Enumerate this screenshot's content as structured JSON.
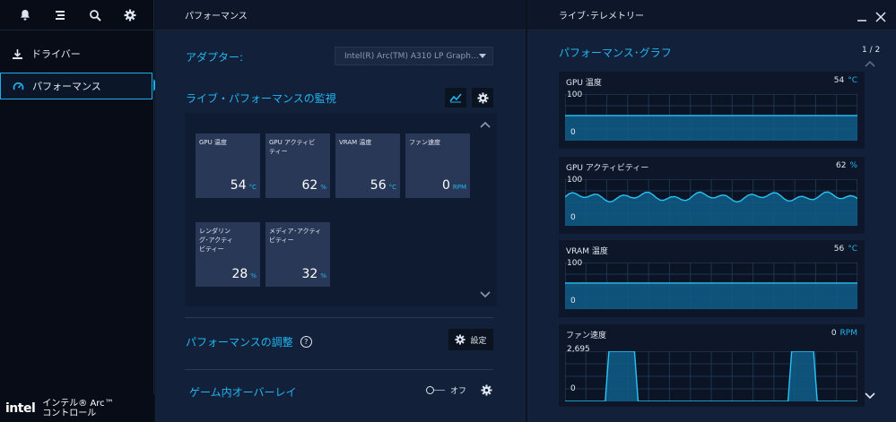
{
  "sidebar": {
    "top_icons": [
      "bell-icon",
      "menu-icon",
      "search-icon",
      "gear-icon"
    ],
    "items": [
      {
        "label": "ドライバー",
        "icon": "download-icon"
      },
      {
        "label": "パフォーマンス",
        "icon": "gauge-icon"
      }
    ],
    "brand": {
      "logo": "intel",
      "line1": "インテル® Arc™",
      "line2": "コントロール"
    }
  },
  "performance": {
    "header": "パフォーマンス",
    "adapter_label": "アダプター:",
    "adapter_value": "Intel(R) Arc(TM) A310 LP Graph…",
    "monitor_title": "ライブ・パフォーマンスの監視",
    "tiles": [
      {
        "label": "GPU 温度",
        "value": "54",
        "unit": "°C"
      },
      {
        "label": "GPU アクティビティー",
        "value": "62",
        "unit": "%"
      },
      {
        "label": "VRAM 温度",
        "value": "56",
        "unit": "°C"
      },
      {
        "label": "ファン速度",
        "value": "0",
        "unit": "RPM"
      },
      {
        "label": "レンダリング･アクティビティー",
        "value": "28",
        "unit": "%"
      },
      {
        "label": "メディア･アクティビティー",
        "value": "32",
        "unit": "%"
      }
    ],
    "tuning_title": "パフォーマンスの調整",
    "settings_label": "設定",
    "overlay_title": "ゲーム内オーバーレイ",
    "overlay_state": "オフ"
  },
  "telemetry": {
    "header": "ライブ･テレメトリー",
    "graph_title": "パフォーマンス･グラフ",
    "page": "1 / 2",
    "graphs": [
      {
        "title": "GPU 温度",
        "value": "54",
        "unit": "°C",
        "max": "100",
        "min": "0",
        "ymax": 100,
        "level": [
          54
        ]
      },
      {
        "title": "GPU アクティビティー",
        "value": "62",
        "unit": "%",
        "max": "100",
        "min": "0",
        "ymax": 100,
        "level": [
          62
        ]
      },
      {
        "title": "VRAM 温度",
        "value": "56",
        "unit": "°C",
        "max": "100",
        "min": "0",
        "ymax": 100,
        "level": [
          56
        ]
      },
      {
        "title": "ファン速度",
        "value": "0",
        "unit": "RPM",
        "max": "2,695",
        "min": "0",
        "ymax": 2695,
        "level": [
          0
        ]
      }
    ]
  },
  "colors": {
    "accent": "#21b7f0",
    "panel": "#12203a",
    "tile": "#2a3857",
    "graph_fill": "#0f5d8a",
    "graph_line": "#29c3f5"
  }
}
